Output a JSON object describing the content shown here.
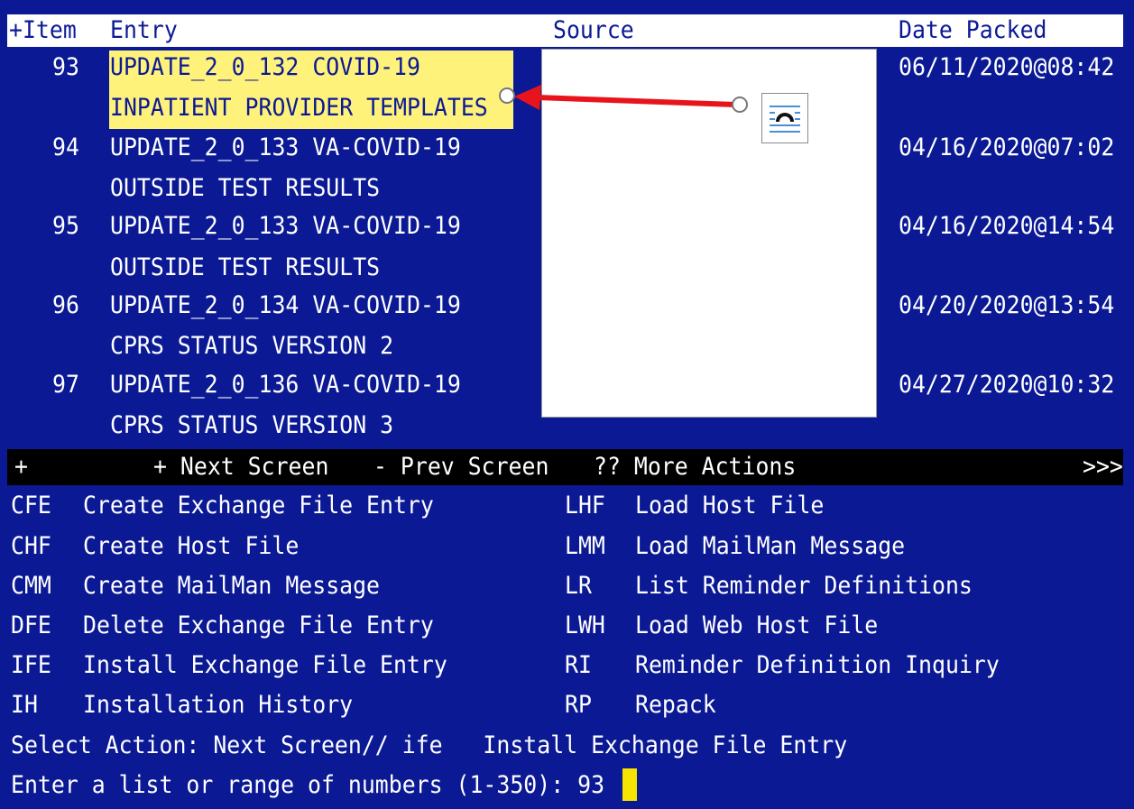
{
  "header": {
    "col_item": "+Item",
    "col_entry": "Entry",
    "col_source": "Source",
    "col_date": "Date Packed"
  },
  "rows": [
    {
      "num": "93",
      "line1": "UPDATE_2_0_132 COVID-19",
      "line2": "INPATIENT PROVIDER TEMPLATES",
      "date": "06/11/2020@08:42"
    },
    {
      "num": "94",
      "line1": "UPDATE_2_0_133 VA-COVID-19",
      "line2": "OUTSIDE TEST RESULTS",
      "date": "04/16/2020@07:02"
    },
    {
      "num": "95",
      "line1": "UPDATE_2_0_133 VA-COVID-19",
      "line2": "OUTSIDE TEST RESULTS",
      "date": "04/16/2020@14:54"
    },
    {
      "num": "96",
      "line1": "UPDATE_2_0_134 VA-COVID-19",
      "line2": "CPRS STATUS VERSION 2",
      "date": "04/20/2020@13:54"
    },
    {
      "num": "97",
      "line1": "UPDATE_2_0_136 VA-COVID-19",
      "line2": "CPRS STATUS VERSION 3",
      "date": "04/27/2020@10:32"
    }
  ],
  "action_bar": {
    "plus": "+",
    "next": "+ Next Screen",
    "prev": "- Prev Screen",
    "more": "?? More Actions",
    "chev": ">>>"
  },
  "actions_left": [
    {
      "code": "CFE",
      "label": "Create Exchange File Entry"
    },
    {
      "code": "CHF",
      "label": "Create Host File"
    },
    {
      "code": "CMM",
      "label": "Create MailMan Message"
    },
    {
      "code": "DFE",
      "label": "Delete Exchange File Entry"
    },
    {
      "code": "IFE",
      "label": "Install Exchange File Entry"
    },
    {
      "code": "IH",
      "label": "Installation History"
    }
  ],
  "actions_right": [
    {
      "code": "LHF",
      "label": "Load Host File"
    },
    {
      "code": "LMM",
      "label": "Load MailMan Message"
    },
    {
      "code": "LR",
      "label": "List Reminder Definitions"
    },
    {
      "code": "LWH",
      "label": "Load Web Host File"
    },
    {
      "code": "RI",
      "label": "Reminder Definition Inquiry"
    },
    {
      "code": "RP",
      "label": "Repack"
    }
  ],
  "prompt1": "Select Action: Next Screen// ife   Install Exchange File Entry",
  "prompt2": "Enter a list or range of numbers (1-350): 93",
  "colors": {
    "background": "#0b1a94",
    "highlight": "#fff27a",
    "arrow": "#e8141c",
    "cursor": "#f5e400"
  },
  "icons": [
    "paragraph-icon"
  ]
}
